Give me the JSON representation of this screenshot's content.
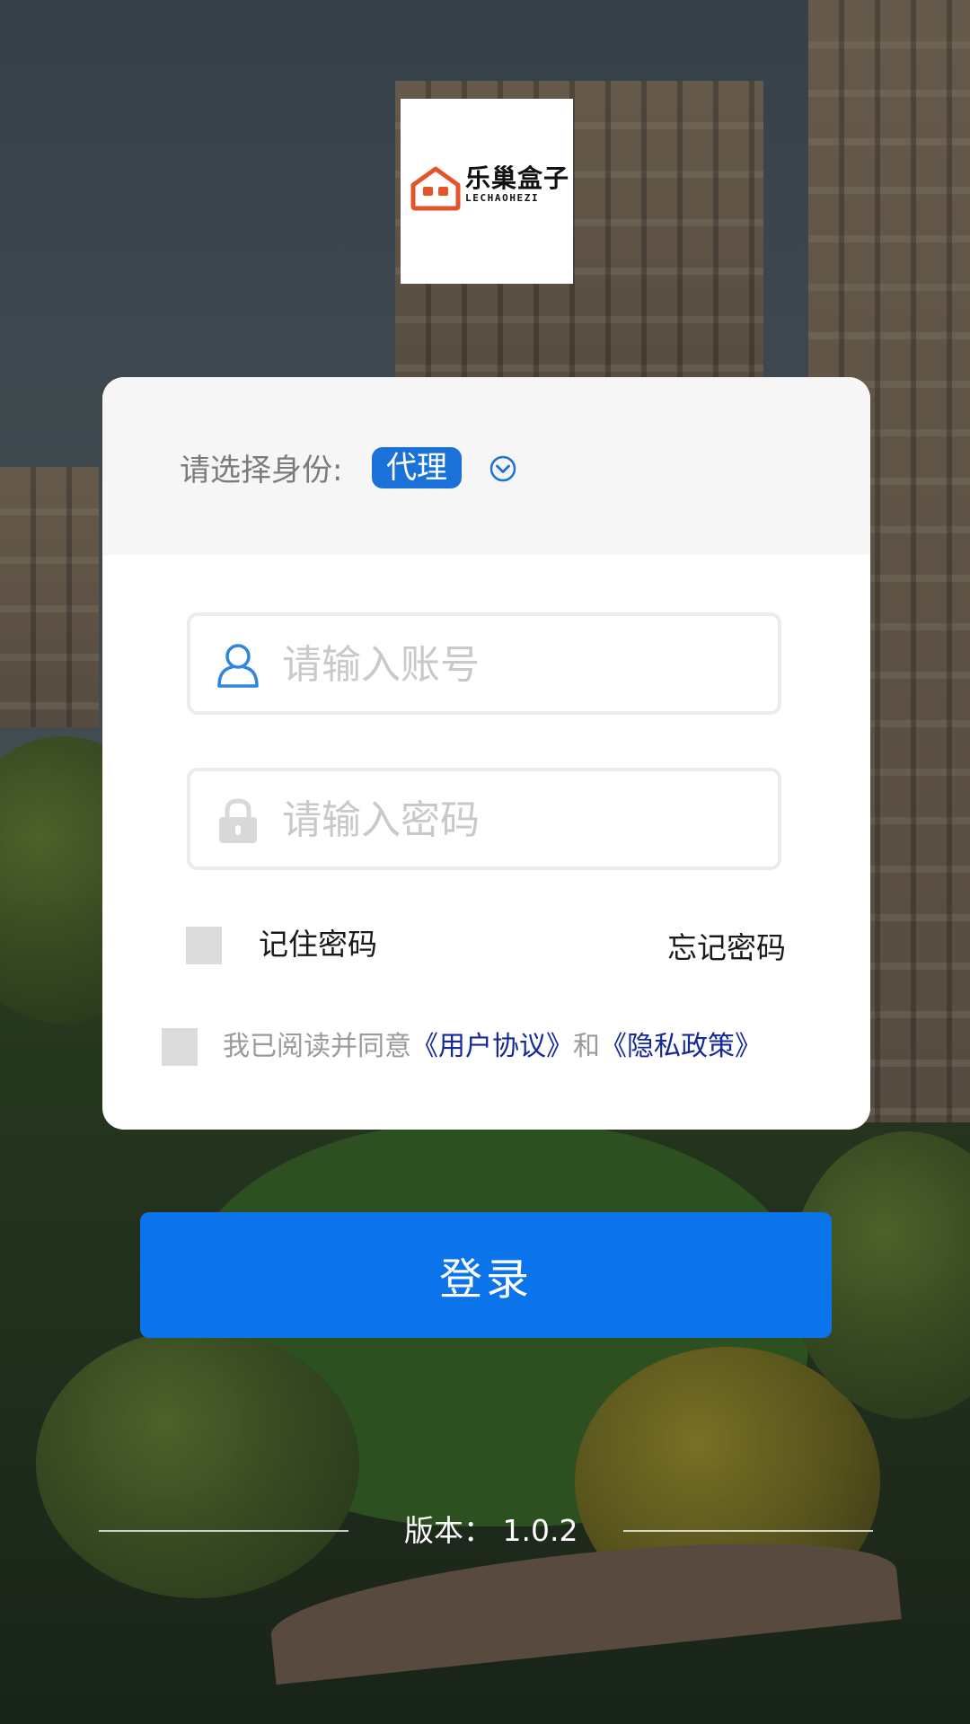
{
  "app": {
    "logo": {
      "name_cn": "乐巢盒子",
      "name_en": "LECHAOHEZI"
    }
  },
  "identity": {
    "label": "请选择身份:",
    "selected": "代理"
  },
  "form": {
    "account_placeholder": "请输入账号",
    "password_placeholder": "请输入密码",
    "remember_label": "记住密码",
    "forgot_label": "忘记密码",
    "agreement": {
      "prefix": "我已阅读并同意",
      "user_agreement": "《用户协议》",
      "conjunction": "和",
      "privacy_policy": "《隐私政策》"
    },
    "remember_checked": false,
    "agree_checked": false
  },
  "login_button": "登录",
  "version": {
    "label": "版本：",
    "value": "1.0.2"
  },
  "colors": {
    "accent": "#0b74ea",
    "badge": "#1a72d9",
    "link": "#14289a",
    "logo_orange": "#e2542a"
  },
  "icons": {
    "account": "user-icon",
    "password": "lock-icon",
    "identity_dropdown": "chevron-down-circle-icon"
  }
}
